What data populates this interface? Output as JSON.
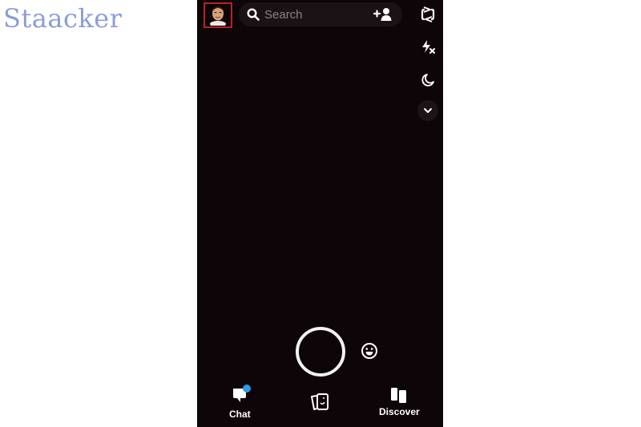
{
  "watermark": "Staacker",
  "topbar": {
    "avatar": "bitmoji-avatar",
    "search_placeholder": "Search",
    "search_icon": "search-icon",
    "add_friend_icon": "add-friend-icon"
  },
  "camera_tools": [
    {
      "name": "flip-camera-icon"
    },
    {
      "name": "flash-off-icon"
    },
    {
      "name": "night-mode-icon"
    },
    {
      "name": "more-tools-chevron-icon"
    }
  ],
  "capture": {
    "shutter": "shutter-button",
    "lenses": "lenses-smiley-icon"
  },
  "bottom_nav": {
    "chat_label": "Chat",
    "memories_icon": "memories-cards-icon",
    "discover_label": "Discover",
    "chat_badge_color": "#2e9be6"
  },
  "colors": {
    "screen_bg": "#0d0507",
    "avatar_border": "#b8202a",
    "watermark": "#8c9cd8"
  }
}
